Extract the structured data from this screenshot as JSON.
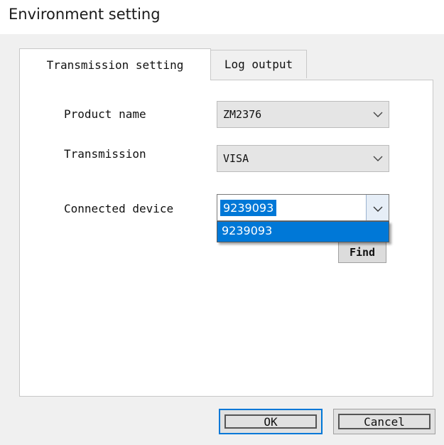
{
  "window": {
    "title": "Environment setting"
  },
  "tabs": [
    {
      "label": "Transmission setting",
      "active": true
    },
    {
      "label": "Log output",
      "active": false
    }
  ],
  "form": {
    "product_name": {
      "label": "Product name",
      "value": "ZM2376"
    },
    "transmission": {
      "label": "Transmission",
      "value": "VISA"
    },
    "connected_device": {
      "label": "Connected device",
      "value": "9239093",
      "options": [
        "9239093"
      ]
    }
  },
  "buttons": {
    "find": "Find",
    "ok": "OK",
    "cancel": "Cancel"
  },
  "colors": {
    "selection": "#0078d7",
    "dialog_bg": "#f0f0f0"
  },
  "icons": {
    "dropdown": "chevron-down-icon"
  }
}
